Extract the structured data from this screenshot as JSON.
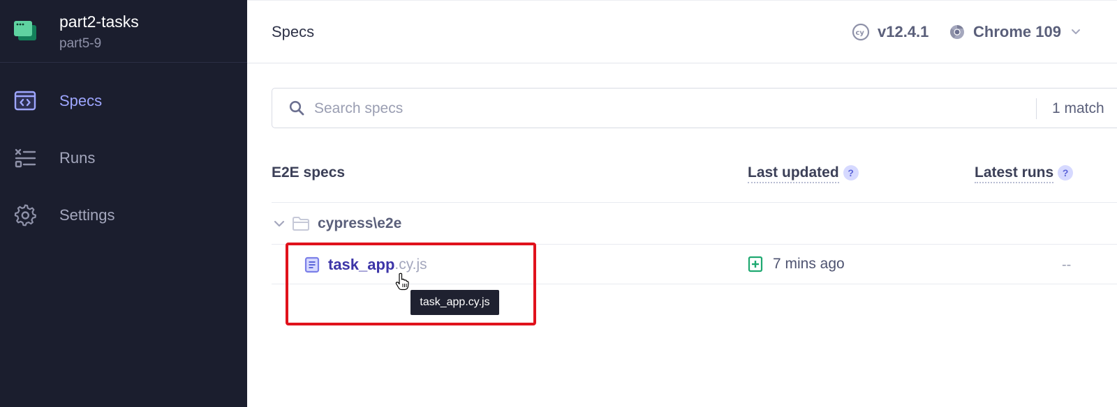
{
  "project": {
    "name": "part2-tasks",
    "branch": "part5-9"
  },
  "sidebar": {
    "items": [
      {
        "label": "Specs",
        "icon": "code-window-icon",
        "active": true
      },
      {
        "label": "Runs",
        "icon": "checklist-icon",
        "active": false
      },
      {
        "label": "Settings",
        "icon": "gear-icon",
        "active": false
      }
    ]
  },
  "header": {
    "title": "Specs",
    "version": "v12.4.1",
    "browser": "Chrome 109"
  },
  "search": {
    "placeholder": "Search specs",
    "match_count": "1 match"
  },
  "table": {
    "columns": {
      "specs": "E2E specs",
      "last_updated": "Last updated",
      "latest_runs": "Latest runs"
    },
    "help_glyph": "?",
    "folder": "cypress\\e2e",
    "rows": [
      {
        "name": "task_app",
        "ext": ".cy.js",
        "last_updated": "7 mins ago",
        "latest_runs": "--"
      }
    ]
  },
  "tooltip": {
    "text": "task_app.cy.js"
  },
  "colors": {
    "sidebar_bg": "#1b1e2e",
    "accent": "#9ea6ff",
    "spec_link": "#3d35a8",
    "highlight": "#e0121c",
    "git_added": "#1fa971"
  }
}
